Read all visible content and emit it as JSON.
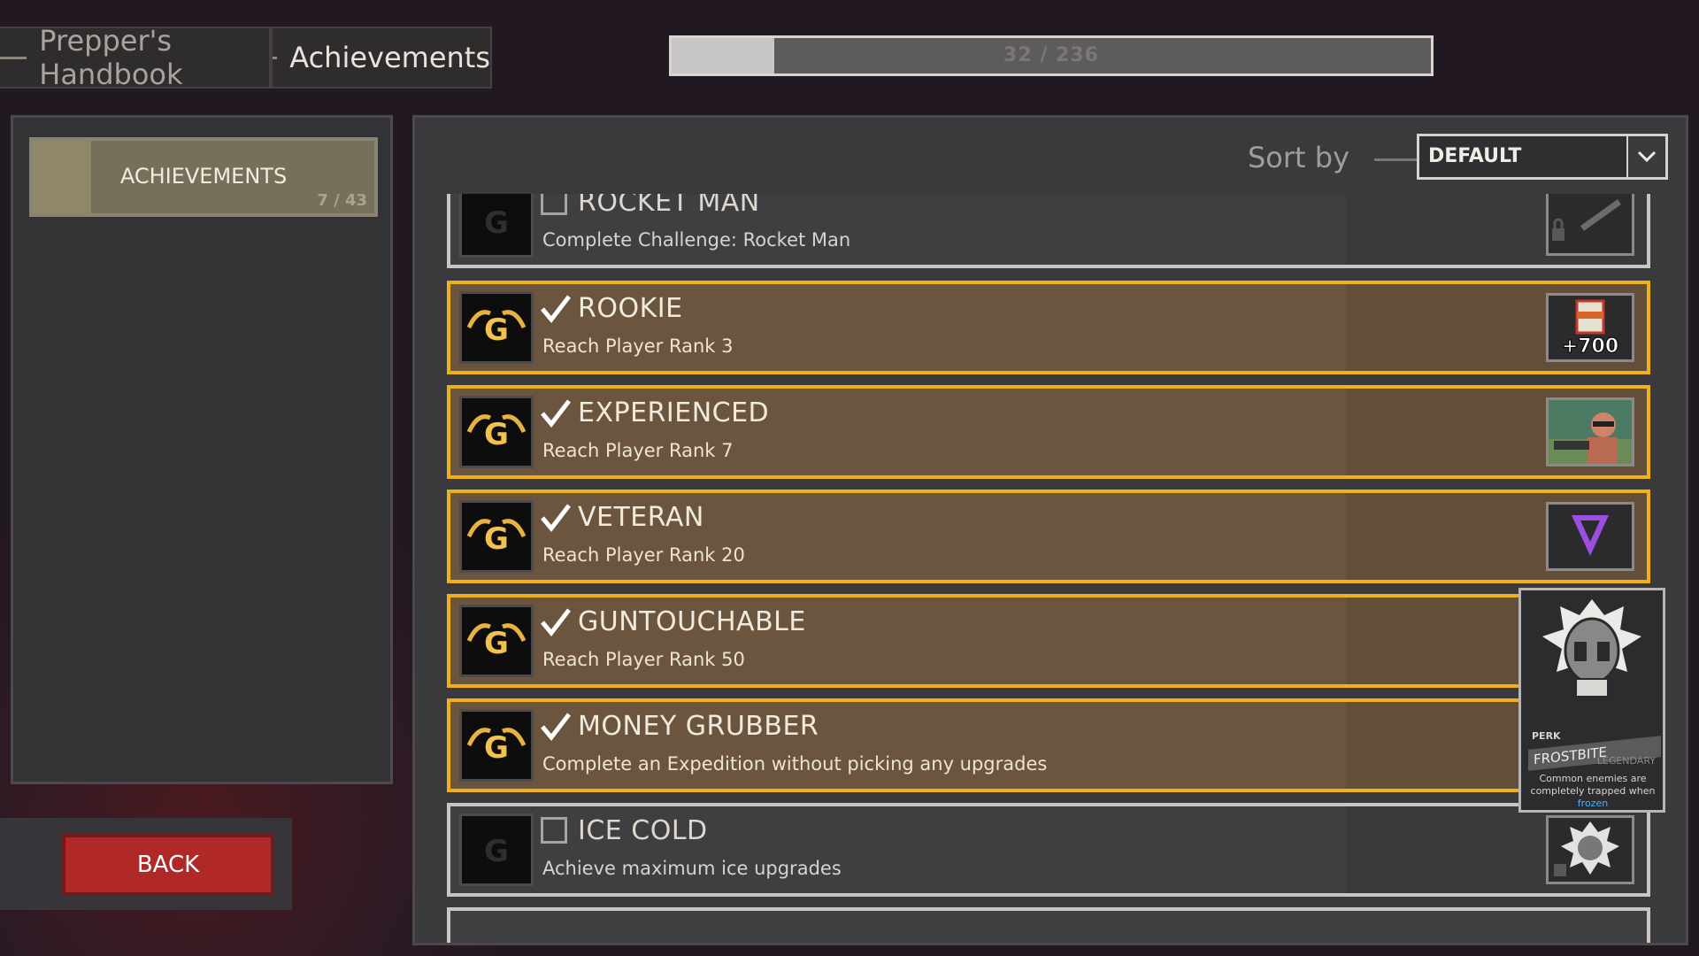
{
  "header": {
    "tabs": [
      {
        "label": "Prepper's Handbook"
      },
      {
        "label": "Achievements"
      }
    ],
    "progress": {
      "text": "32 / 236",
      "fraction": 0.1356
    }
  },
  "sidebar": {
    "category": {
      "label": "ACHIEVEMENTS",
      "count": "7 / 43"
    }
  },
  "back_label": "BACK",
  "sort": {
    "label": "Sort by",
    "value": "DEFAULT"
  },
  "achievements": [
    {
      "title": "ROCKET MAN",
      "desc": "Complete Challenge: Rocket Man",
      "done": false,
      "reward_icon": "rocket-launcher-icon",
      "reward_locked": true
    },
    {
      "title": "ROOKIE",
      "desc": "Reach Player Rank 3",
      "done": true,
      "reward_icon": "currency-can-icon",
      "reward_text": "+700"
    },
    {
      "title": "EXPERIENCED",
      "desc": "Reach Player Rank 7",
      "done": true,
      "reward_icon": "character-portrait-icon"
    },
    {
      "title": "VETERAN",
      "desc": "Reach Player Rank 20",
      "done": true,
      "reward_icon": "rank-chevron-icon"
    },
    {
      "title": "GUNTOUCHABLE",
      "desc": "Reach Player Rank 50",
      "done": true,
      "reward_icon": "perk-card-icon"
    },
    {
      "title": "MONEY GRUBBER",
      "desc": "Complete an Expedition without picking any upgrades",
      "done": true,
      "reward_icon": "perk-card-icon"
    },
    {
      "title": "ICE COLD",
      "desc": "Achieve maximum ice upgrades",
      "done": false,
      "reward_icon": "frost-skull-icon",
      "reward_locked": true
    }
  ],
  "tooltip": {
    "tier": "PERK",
    "name": "FROSTBITE",
    "rarity": "LEGENDARY",
    "text_before": "Common enemies are completely trapped when",
    "text_keyword": "frozen"
  },
  "colors": {
    "completed_border": "#f0b117",
    "completed_bg": "#6b553e",
    "back_button": "#b02828"
  }
}
